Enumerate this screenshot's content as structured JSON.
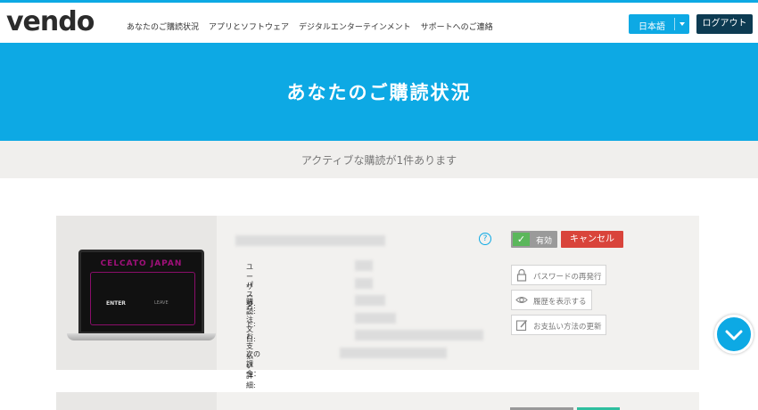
{
  "header": {
    "logo": "vendo",
    "nav": [
      "あなたのご購読状況",
      "アプリとソフトウェア",
      "デジタルエンターテインメント",
      "サポートへのご連絡"
    ],
    "language_label": "日本語",
    "logout_label": "ログアウト"
  },
  "hero": {
    "title": "あなたのご購読状況"
  },
  "summary": "アクティブな購読が1件あります",
  "subscription": {
    "thumbnail": {
      "site_title": "CELCATO JAPAN",
      "enter_label": "ENTER",
      "leave_label": "LEAVE"
    },
    "fields": [
      "ユーザー名:",
      "パスワード:",
      "購読:",
      "注文日:",
      "お支払い詳細:",
      "次の課金："
    ],
    "help_symbol": "?",
    "status_label": "有効",
    "cancel_label": "キャンセル",
    "actions": [
      {
        "label": "パスワードの再発行",
        "icon": "lock-icon"
      },
      {
        "label": "履歴を表示する",
        "icon": "eye-icon"
      },
      {
        "label": "お支払い方法の更新",
        "icon": "edit-icon"
      }
    ]
  },
  "colors": {
    "accent": "#0da9e4",
    "dark_button": "#0d3b52",
    "cancel": "#d9443b",
    "status_check": "#5bb75b",
    "teal": "#2fbf9f"
  }
}
